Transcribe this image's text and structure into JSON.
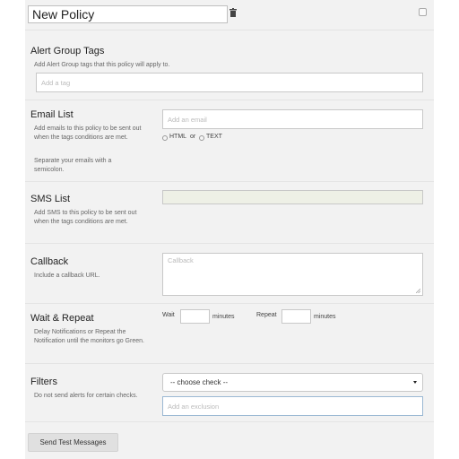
{
  "policy": {
    "name": "New Policy"
  },
  "alert_group_tags": {
    "heading": "Alert Group Tags",
    "help": "Add Alert Group tags that this policy will apply to.",
    "placeholder": "Add a tag"
  },
  "email_list": {
    "heading": "Email List",
    "help1": "Add emails to this policy to be sent out when the tags conditions are met.",
    "help2": "Separate your emails with a semicolon.",
    "placeholder": "Add an email",
    "format_html": "HTML",
    "format_or": "or",
    "format_text": "TEXT"
  },
  "sms_list": {
    "heading": "SMS List",
    "help": "Add SMS to this policy to be sent out when the tags conditions are met."
  },
  "callback": {
    "heading": "Callback",
    "help": "Include a callback URL.",
    "placeholder": "Callback"
  },
  "wait_repeat": {
    "heading": "Wait & Repeat",
    "help": "Delay Notifications or Repeat the Notification until the monitors go Green.",
    "wait_label": "Wait",
    "wait_unit": "minutes",
    "repeat_label": "Repeat",
    "repeat_unit": "minutes"
  },
  "filters": {
    "heading": "Filters",
    "help": "Do not send alerts for certain checks.",
    "select_value": "-- choose check --",
    "exclusion_placeholder": "Add an exclusion"
  },
  "actions": {
    "send_test": "Send Test Messages"
  },
  "colors": {
    "panel": "#f2f2f2",
    "sms_field": "#eef0e6",
    "focus_border": "#9bb8d3"
  }
}
